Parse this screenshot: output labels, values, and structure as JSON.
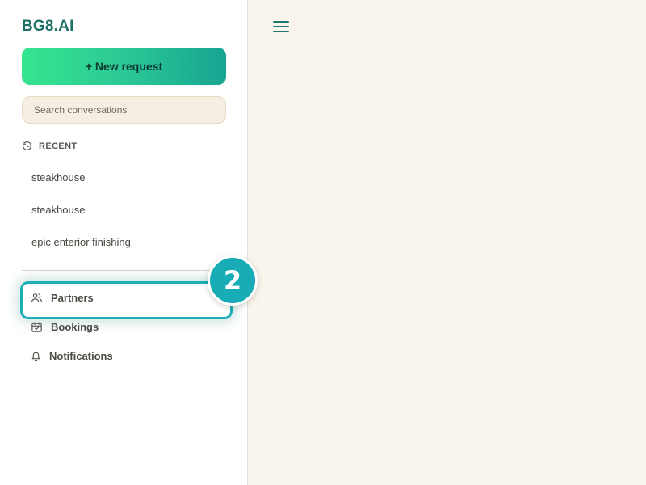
{
  "sidebar": {
    "brand": "BG8.AI",
    "new_request_label": "+ New request",
    "search_placeholder": "Search conversations",
    "recent_label": "RECENT",
    "conversations": [
      {
        "title": "steakhouse"
      },
      {
        "title": "steakhouse"
      },
      {
        "title": "epic enterior finishing"
      }
    ],
    "nav": [
      {
        "label": "Partners",
        "icon": "users-icon"
      },
      {
        "label": "Bookings",
        "icon": "calendar-check-icon"
      },
      {
        "label": "Notifications",
        "icon": "bell-icon"
      }
    ]
  },
  "annotation": {
    "step_number": "2",
    "highlight_target": "Partners"
  },
  "main": {
    "menu_icon": "hamburger-menu-icon"
  },
  "colors": {
    "brand": "#1d6f64",
    "accent_gradient_start": "#35e58e",
    "accent_gradient_end": "#17a491",
    "highlight": "#1bb0b8",
    "sidebar_bg": "#ffffff",
    "main_bg": "#f9f5ed",
    "search_bg": "#f5eee2"
  }
}
